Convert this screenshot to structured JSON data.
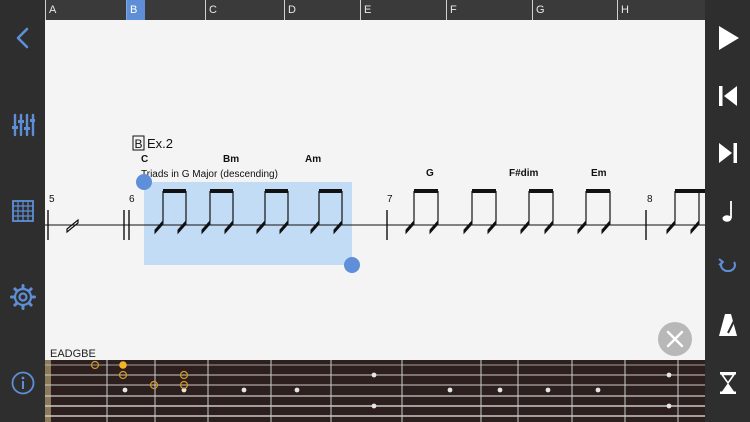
{
  "sections": [
    {
      "label": "A",
      "active": false
    },
    {
      "label": "B",
      "active": true
    },
    {
      "label": "C",
      "active": false
    },
    {
      "label": "D",
      "active": false
    },
    {
      "label": "E",
      "active": false
    },
    {
      "label": "F",
      "active": false
    },
    {
      "label": "G",
      "active": false
    },
    {
      "label": "H",
      "active": false
    }
  ],
  "score": {
    "rehearsal_mark": "B",
    "title": "Ex.2",
    "subtitle": "Triads in G Major (descending)",
    "measure_numbers": [
      "5",
      "6",
      "7",
      "8"
    ],
    "chords": [
      "C",
      "Bm",
      "Am",
      "G",
      "F#dim",
      "Em"
    ]
  },
  "fretboard": {
    "tuning": "EADGBE"
  },
  "colors": {
    "accent": "#5e8fd6",
    "selection": "#c3dcf5",
    "handle": "#5f8fd8",
    "fret_marker_active": "#f2b628",
    "wood": "#2d1f1d"
  },
  "icons": {
    "back": "chevron-left-icon",
    "mixer": "sliders-icon",
    "fretboard": "fretboard-grid-icon",
    "settings": "gear-icon",
    "info": "info-icon",
    "play": "play-icon",
    "rewind": "skip-back-icon",
    "forward": "skip-forward-icon",
    "note": "eighth-note-icon",
    "loop": "loop-icon",
    "metronome": "metronome-icon",
    "timer": "hourglass-icon",
    "close": "close-icon"
  }
}
